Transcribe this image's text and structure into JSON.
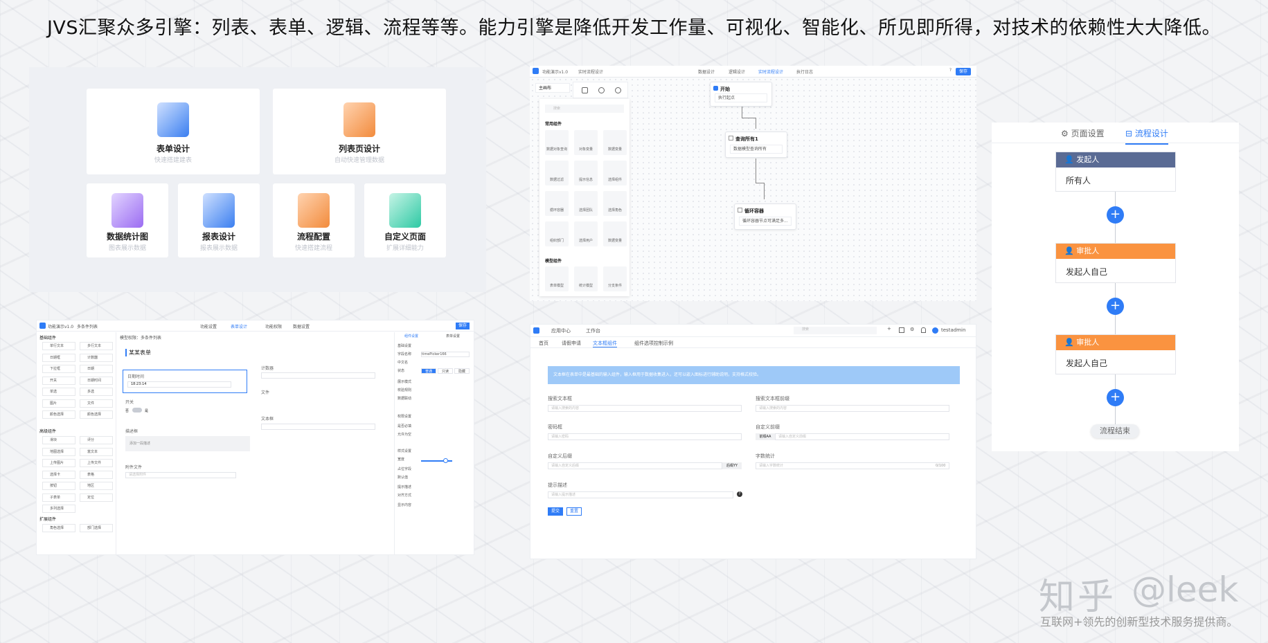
{
  "headline": "JVS汇聚众多引擎：列表、表单、逻辑、流程等等。能力引擎是降低开发工作量、可视化、智能化、所见即所得，对技术的依赖性大大降低。",
  "cards": [
    {
      "title": "表单设计",
      "sub": "快速搭建建表",
      "color": "#3b7ff0"
    },
    {
      "title": "列表页设计",
      "sub": "自动快速管理数据",
      "color": "#f28b3c"
    },
    {
      "title": "数据统计图",
      "sub": "图表展示数据",
      "color": "#9b6cf2"
    },
    {
      "title": "报表设计",
      "sub": "报表展示数据",
      "color": "#3b7ff0"
    },
    {
      "title": "流程配置",
      "sub": "快速搭建流程",
      "color": "#f28b3c"
    },
    {
      "title": "自定义页面",
      "sub": "扩展详细能力",
      "color": "#2ec9a4"
    }
  ],
  "flow": {
    "app_title": "功能演示v1.0",
    "breadcrumb": "实时流程设计",
    "top_tabs": [
      "数据设计",
      "逻辑设计",
      "实时流程设计",
      "执行日志"
    ],
    "save": "保存",
    "left_tab": "主画布",
    "search_placeholder": "搜索",
    "group1": "常用组件",
    "group2": "模型组件",
    "components": [
      "数据对象查询",
      "对象变量",
      "数据变量",
      "数据过滤",
      "提示信息",
      "选择组件",
      "循环容器",
      "选择团队",
      "选择角色",
      "组织部门",
      "选择用户",
      "数据变量"
    ],
    "components2": [
      "表单模型",
      "统计模型",
      "分支条件"
    ],
    "nodes": [
      {
        "title": "开始",
        "body": "执行起点"
      },
      {
        "title": "查询所有1",
        "body": "数据模型查询所有"
      },
      {
        "title": "循环容器",
        "body": "循环容器节点可满足多..."
      }
    ]
  },
  "process": {
    "tab_page": "页面设置",
    "tab_flow": "流程设计",
    "steps": [
      {
        "head": "发起人",
        "body": "所有人",
        "color": "#5a6b94"
      },
      {
        "head": "审批人",
        "body": "发起人自己",
        "color": "#fa9340"
      },
      {
        "head": "审批人",
        "body": "发起人自己",
        "color": "#fa9340"
      }
    ],
    "end": "流程结束"
  },
  "form": {
    "app_title": "功能演示v1.0",
    "breadcrumb": "多条件列表",
    "tabs": [
      "功能设置",
      "表单设计",
      "功能权限",
      "数据设置"
    ],
    "save": "保存",
    "model": "模型权限：多条件列表",
    "groups": [
      "基础组件",
      "高级组件",
      "扩展组件"
    ],
    "components": [
      "单行文本",
      "多行文本",
      "日期框",
      "计数器",
      "下拉框",
      "日期",
      "开关",
      "日期时间",
      "单选",
      "多选",
      "图片",
      "文件",
      "颜色选择",
      "颜色选择",
      "滑块",
      "评分",
      "地图选择",
      "富文本",
      "上传图片",
      "上传文件",
      "选择卡",
      "表格",
      "按钮",
      "地区",
      "子表单",
      "定位",
      "多列选择",
      "部门选择",
      "角色选择"
    ],
    "canvas_title": "某某表单",
    "fields": [
      "日期时间",
      "开关",
      "描述框",
      "附件文件",
      "计数器",
      "文件",
      "文本框"
    ],
    "date_value": "18:23:14",
    "switch_off": "否",
    "switch_on": "是",
    "desc_placeholder": "添加一段描述",
    "file_placeholder": "请选择附件",
    "right_tabs": [
      "组件设置",
      "表单设置"
    ],
    "right_groups": [
      "基础设置",
      "权限设置",
      "样式设置"
    ],
    "right_fields": [
      "字段名称",
      "中文名",
      "状态",
      "展示模式",
      "校验规则",
      "数据联动",
      "是否必填",
      "允许为空",
      "宽度",
      "占位字段",
      "默认值",
      "提示描述",
      "对齐方式",
      "显示内容"
    ],
    "field_value": "timePicker166",
    "status_opts": [
      "普通",
      "只读",
      "隐藏"
    ]
  },
  "textpage": {
    "nav": [
      "应用中心",
      "工作台"
    ],
    "search_placeholder": "搜索",
    "user": "testadmin",
    "tabs": [
      "首页",
      "请假申请",
      "文本框组件",
      "组件选项控制示例"
    ],
    "banner": "文本框在表单中是最基础的输入组件，输入框用于数据收集进入，还可以嵌入图标进行辅助说明，支持格式校验。",
    "fields": [
      {
        "label": "搜索文本框",
        "placeholder": "请输入搜索的内容"
      },
      {
        "label": "搜索文本框前缀",
        "placeholder": "请输入搜索的内容"
      },
      {
        "label": "密码框",
        "placeholder": "请输入密码"
      },
      {
        "label": "自定义前缀",
        "placeholder": "请输入自定义前缀"
      },
      {
        "label": "自定义后缀",
        "placeholder": "请输入自定义后缀"
      },
      {
        "label": "字数统计",
        "placeholder": "请输入字数统计"
      },
      {
        "label": "提示描述",
        "placeholder": "请输入提示描述"
      }
    ],
    "prefix": "前缀AA",
    "suffix": "后缀YY",
    "count": "0/100",
    "submit": "提交",
    "reset": "重置"
  },
  "watermark": {
    "brand": "知乎",
    "handle": "@leek",
    "tagline": "互联网+领先的创新型技术服务提供商。"
  }
}
